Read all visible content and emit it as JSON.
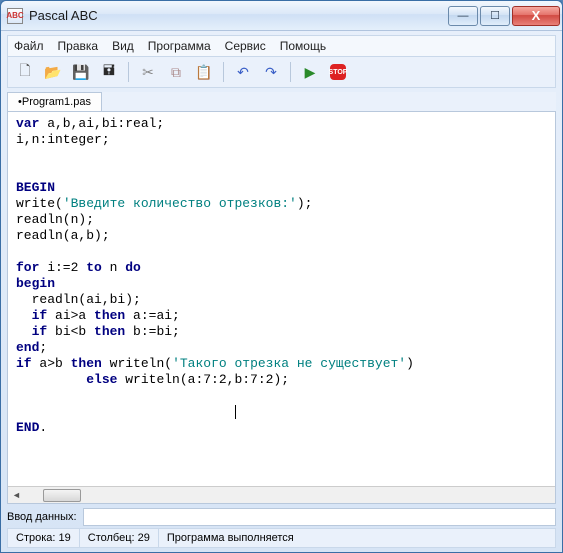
{
  "window": {
    "title": "Pascal ABC",
    "app_icon_text": "ABC"
  },
  "winbtns": {
    "min": "—",
    "max": "☐",
    "close": "X"
  },
  "menu": {
    "file": "Файл",
    "edit": "Правка",
    "view": "Вид",
    "program": "Программа",
    "service": "Сервис",
    "help": "Помощь"
  },
  "toolbar": {
    "new": "🗋",
    "open": "📂",
    "save": "💾",
    "saveall": "🖬",
    "cut": "✂",
    "copy": "⧉",
    "paste": "📋",
    "undo": "↶",
    "redo": "↷",
    "run": "▶",
    "stop": "STOP"
  },
  "tabs": {
    "file1": "•Program1.pas"
  },
  "code": {
    "l1a": "var",
    "l1b": " a,b,ai,bi:real;",
    "l2": "i,n:integer;",
    "l5": "BEGIN",
    "l6a": "write(",
    "l6b": "'Введите количество отрезков:'",
    "l6c": ");",
    "l7": "readln(n);",
    "l8": "readln(a,b);",
    "l10a": "for",
    "l10b": " i:=2 ",
    "l10c": "to",
    "l10d": " n ",
    "l10e": "do",
    "l11": "begin",
    "l12": "  readln(ai,bi);",
    "l13a": "  ",
    "l13b": "if",
    "l13c": " ai>a ",
    "l13d": "then",
    "l13e": " a:=ai;",
    "l14a": "  ",
    "l14b": "if",
    "l14c": " bi<b ",
    "l14d": "then",
    "l14e": " b:=bi;",
    "l15a": "end",
    "l15b": ";",
    "l16a": "if",
    "l16b": " a>b ",
    "l16c": "then",
    "l16d": " writeln(",
    "l16e": "'Такого отрезка не существует'",
    "l16f": ")",
    "l17a": "         ",
    "l17b": "else",
    "l17c": " writeln(a:7:2,b:7:2);",
    "l20a": "END",
    "l20b": "."
  },
  "input": {
    "label": "Ввод данных:",
    "value": ""
  },
  "status": {
    "line_label": "Строка:",
    "line_val": "19",
    "col_label": "Столбец:",
    "col_val": "29",
    "msg": "Программа выполняется"
  },
  "scroll": {
    "left": "◄",
    "right": "►"
  }
}
